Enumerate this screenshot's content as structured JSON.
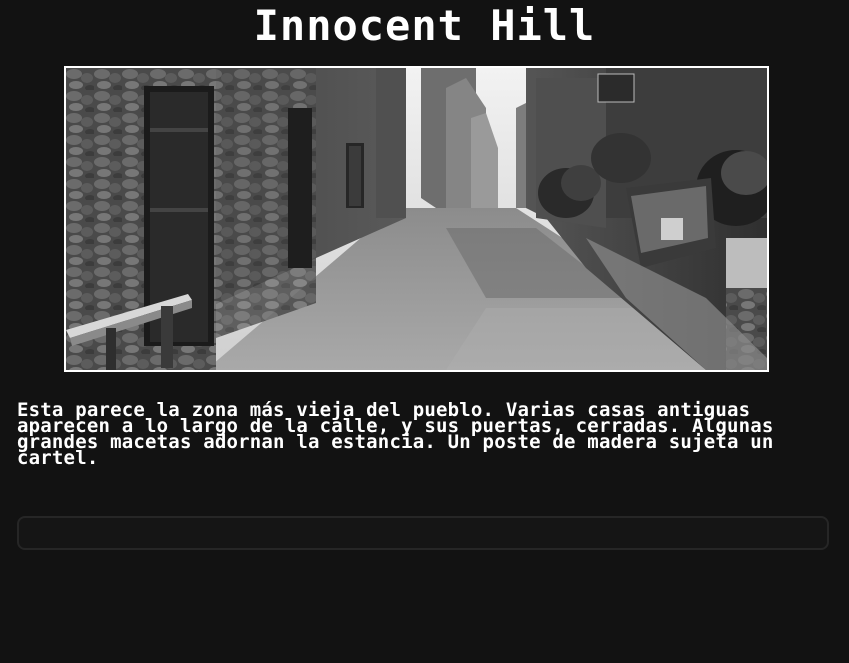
{
  "game": {
    "title": "Innocent Hill"
  },
  "scene": {
    "image_label": "old-town-street",
    "description": "Esta parece la zona más vieja del pueblo. Varias casas antiguas aparecen a lo largo de la calle, y sus puertas, cerradas. Algunas grandes macetas adornan la estancia. Un poste de madera sujeta un cartel."
  },
  "command": {
    "value": "",
    "placeholder": ""
  },
  "colors": {
    "background": "#121212",
    "text": "#ffffff",
    "frame": "#ffffff",
    "input_border": "#262626"
  }
}
